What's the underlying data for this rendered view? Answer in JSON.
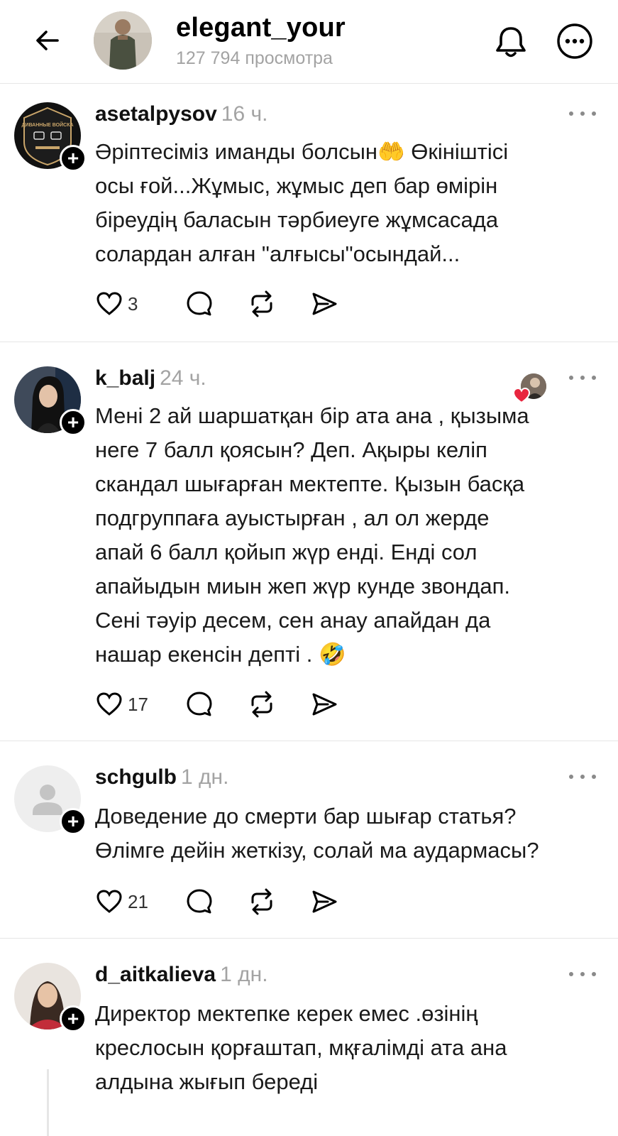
{
  "header": {
    "username": "elegant_your",
    "views": "127 794 просмотра"
  },
  "posts": [
    {
      "username": "asetalpysov",
      "time": "16 ч.",
      "text": "Әріптесіміз иманды болсын🤲 Өкініштісі\nосы ғой...Жұмыс, жұмыс  деп бар өмірін\nбіреудің баласын тәрбиеуге жұмсасада\nсолардан алған \"алғысы\"осындай...",
      "likes": "3",
      "avatar_label": "ДИВАННЫЕ ВОЙСКА"
    },
    {
      "username": "k_balj",
      "time": "24 ч.",
      "text": "Мені 2 ай шаршатқан бір ата ана , қызыма\nнеге 7 балл қоясын? Деп. Ақыры келіп\nскандал шығарған мектепте. Қызын басқа\nподгруппаға ауыстырған , ал ол жерде\nапай 6 балл қойып жүр енді. Енді сол\nапайыдын миын жеп жүр кунде звондап.\nСені тәуір десем, сен анау апайдан да\nнашар екенсін депті . 🤣",
      "likes": "17"
    },
    {
      "username": "schgulb",
      "time": "1 дн.",
      "text": "Доведение до смерти бар шығар статья?\nӨлімге дейін жеткізу, солай ма аудармасы?",
      "likes": "21"
    },
    {
      "username": "d_aitkalieva",
      "time": "1 дн.",
      "text": "Директор мектепке керек емес .өзінің\nкреслосын қорғаштап, мқғалімді ата ана\nалдына жығып береді"
    }
  ],
  "icons": {
    "back": "arrow-left-icon",
    "bell": "bell-icon",
    "more": "more-horizontal-icon",
    "like": "heart-icon",
    "reply": "comment-icon",
    "repost": "repost-icon",
    "share": "send-icon",
    "follow": "plus-icon"
  },
  "colors": {
    "text": "#000000",
    "muted": "#a3a3a3",
    "divider": "#e6e6e6",
    "heart": "#e8263f"
  }
}
